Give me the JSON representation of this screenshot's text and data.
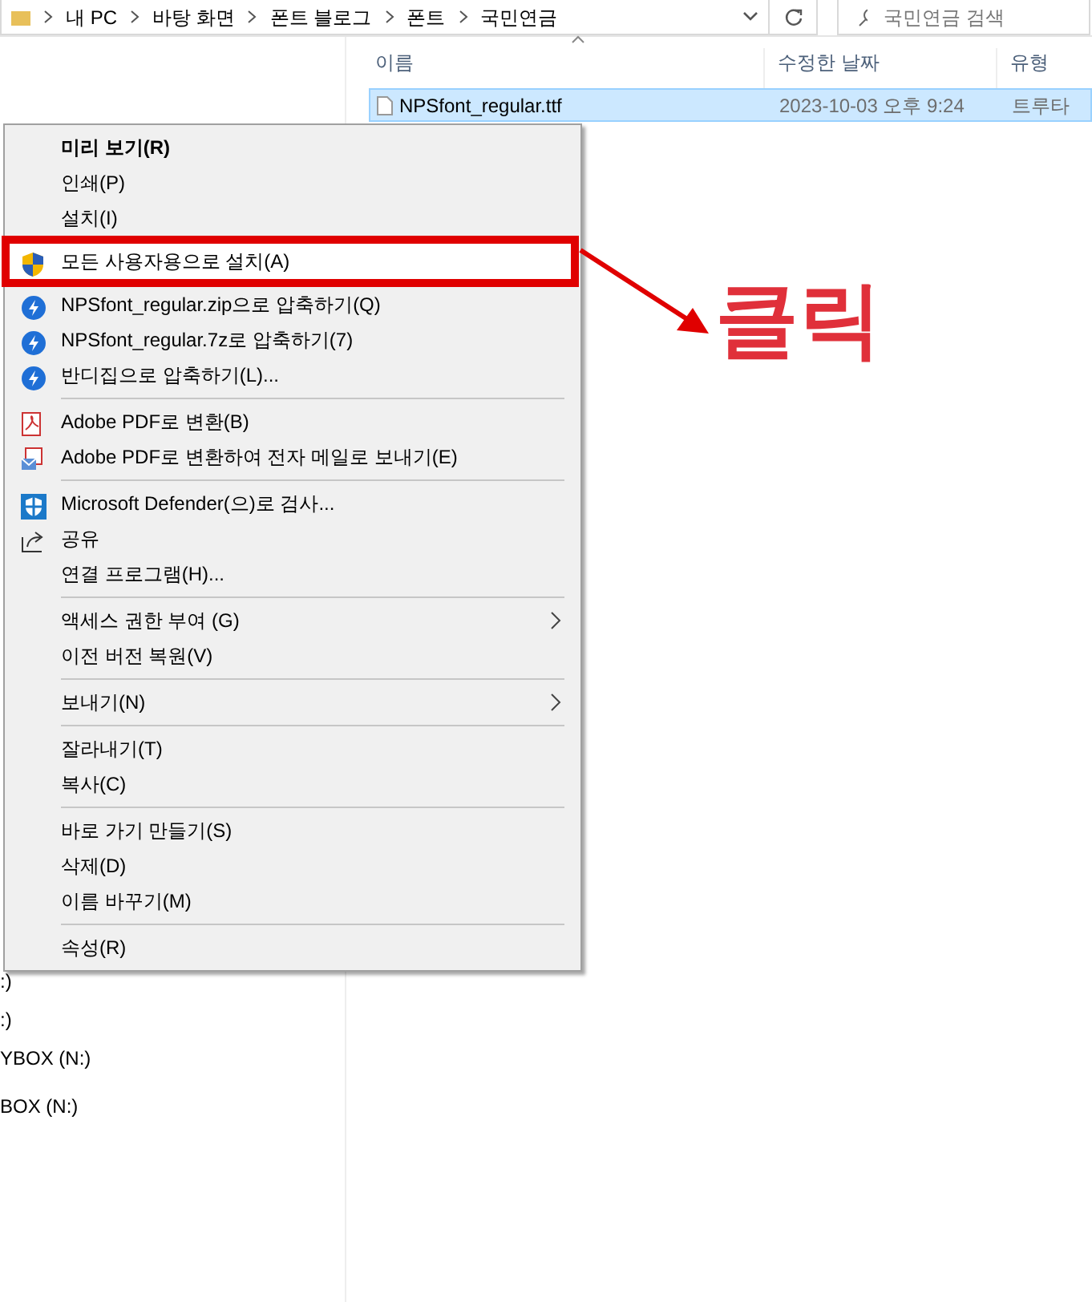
{
  "address_bar": {
    "path": [
      "내 PC",
      "바탕 화면",
      "폰트 블로그",
      "폰트",
      "국민연금"
    ]
  },
  "search": {
    "placeholder": "국민연금 검색"
  },
  "nav_pane": {
    "items": [
      ":)",
      ":)",
      "YBOX (N:)",
      "BOX (N:)"
    ]
  },
  "file_list": {
    "columns": [
      "이름",
      "수정한 날짜",
      "유형"
    ],
    "rows": [
      {
        "name": "NPSfont_regular.ttf",
        "modified": "2023-10-03 오후 9:24",
        "type": "트루타",
        "selected": true
      }
    ]
  },
  "context_menu": {
    "groups": [
      [
        {
          "label": "미리 보기(R)",
          "kind": "plain",
          "bold": true,
          "submenu": false,
          "highlighted": false
        },
        {
          "label": "인쇄(P)",
          "kind": "plain",
          "bold": false,
          "submenu": false,
          "highlighted": false
        },
        {
          "label": "설치(I)",
          "kind": "plain",
          "bold": false,
          "submenu": false,
          "highlighted": false
        },
        {
          "label": "모든 사용자용으로 설치(A)",
          "kind": "shield",
          "bold": false,
          "submenu": false,
          "highlighted": true
        },
        {
          "label": "NPSfont_regular.zip으로 압축하기(Q)",
          "kind": "bandizip",
          "bold": false,
          "submenu": false,
          "highlighted": false
        },
        {
          "label": "NPSfont_regular.7z로 압축하기(7)",
          "kind": "bandizip",
          "bold": false,
          "submenu": false,
          "highlighted": false
        },
        {
          "label": "반디집으로 압축하기(L)...",
          "kind": "bandizip",
          "bold": false,
          "submenu": false,
          "highlighted": false
        }
      ],
      [
        {
          "label": "Adobe PDF로 변환(B)",
          "kind": "pdf",
          "bold": false,
          "submenu": false,
          "highlighted": false
        },
        {
          "label": "Adobe PDF로 변환하여 전자 메일로 보내기(E)",
          "kind": "pdf-mail",
          "bold": false,
          "submenu": false,
          "highlighted": false
        }
      ],
      [
        {
          "label": "Microsoft Defender(으)로 검사...",
          "kind": "defender",
          "bold": false,
          "submenu": false,
          "highlighted": false
        },
        {
          "label": "공유",
          "kind": "share",
          "bold": false,
          "submenu": false,
          "highlighted": false
        },
        {
          "label": "연결 프로그램(H)...",
          "kind": "plain",
          "bold": false,
          "submenu": false,
          "highlighted": false
        }
      ],
      [
        {
          "label": "액세스 권한 부여 (G)",
          "kind": "plain",
          "bold": false,
          "submenu": true,
          "highlighted": false
        },
        {
          "label": "이전 버전 복원(V)",
          "kind": "plain",
          "bold": false,
          "submenu": false,
          "highlighted": false
        }
      ],
      [
        {
          "label": "보내기(N)",
          "kind": "plain",
          "bold": false,
          "submenu": true,
          "highlighted": false
        }
      ],
      [
        {
          "label": "잘라내기(T)",
          "kind": "plain",
          "bold": false,
          "submenu": false,
          "highlighted": false
        },
        {
          "label": "복사(C)",
          "kind": "plain",
          "bold": false,
          "submenu": false,
          "highlighted": false
        }
      ],
      [
        {
          "label": "바로 가기 만들기(S)",
          "kind": "plain",
          "bold": false,
          "submenu": false,
          "highlighted": false
        },
        {
          "label": "삭제(D)",
          "kind": "plain",
          "bold": false,
          "submenu": false,
          "highlighted": false
        },
        {
          "label": "이름 바꾸기(M)",
          "kind": "plain",
          "bold": false,
          "submenu": false,
          "highlighted": false
        }
      ],
      [
        {
          "label": "속성(R)",
          "kind": "plain",
          "bold": false,
          "submenu": false,
          "highlighted": false
        }
      ]
    ]
  },
  "annotation": {
    "label": "클릭"
  }
}
